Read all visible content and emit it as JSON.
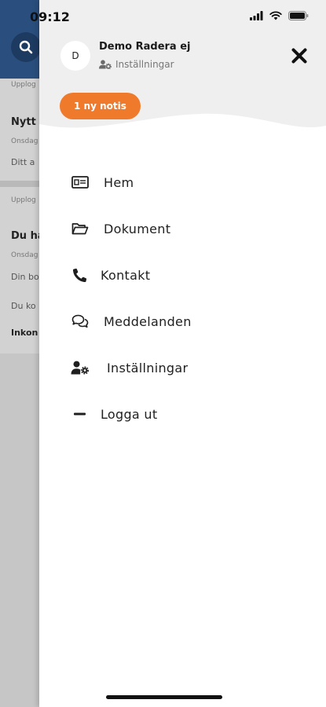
{
  "status_bar": {
    "time": "09:12"
  },
  "background": {
    "sections": [
      "Upplog",
      "Upplog"
    ],
    "items": [
      {
        "title": "Nytt",
        "date": "Onsdag",
        "preview": "Ditt a"
      },
      {
        "title": "Du ha",
        "date": "Onsdag",
        "preview": "Din bo"
      }
    ],
    "extra_line": "Du ko",
    "extra_bold": "Inkon"
  },
  "drawer": {
    "avatar_initial": "D",
    "user_name": "Demo Radera ej",
    "settings_link_label": "Inställningar",
    "notification_button": "1 ny notis",
    "menu": [
      {
        "label": "Hem",
        "icon": "id-card-icon"
      },
      {
        "label": "Dokument",
        "icon": "folder-icon"
      },
      {
        "label": "Kontakt",
        "icon": "phone-icon"
      },
      {
        "label": "Meddelanden",
        "icon": "chat-icon"
      },
      {
        "label": "Inställningar",
        "icon": "user-settings-icon"
      },
      {
        "label": "Logga ut",
        "icon": "minus-icon"
      }
    ]
  },
  "colors": {
    "accent": "#f07a2b",
    "header_background": "#2a4f7e",
    "drawer_top": "#efefef"
  }
}
